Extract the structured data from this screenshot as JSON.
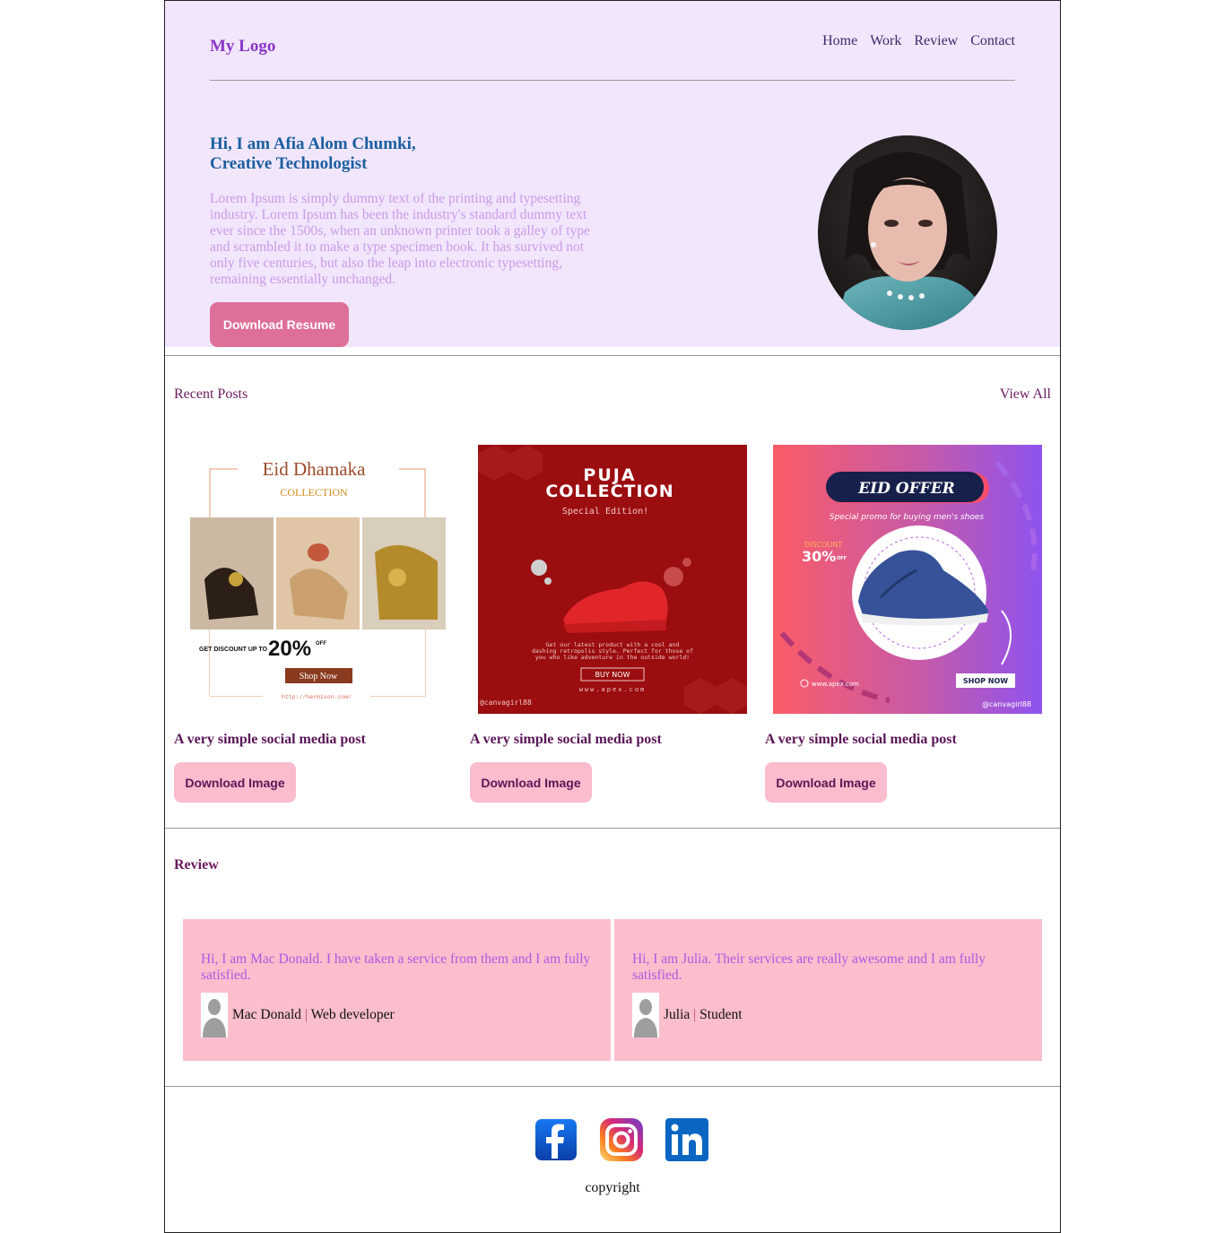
{
  "header": {
    "logo": "My Logo",
    "nav": [
      "Home",
      "Work",
      "Review",
      "Contact"
    ]
  },
  "hero": {
    "title_line1": "Hi, I am Afia Alom Chumki,",
    "title_line2": "Creative Technologist",
    "text": "Lorem Ipsum is simply dummy text of the printing and typesetting industry. Lorem Ipsum has been the industry's standard dummy text ever since the 1500s, when an unknown printer took a galley of type and scrambled it to make a type specimen book. It has survived not only five centuries, but also the leap into electronic typesetting, remaining essentially unchanged.",
    "button": "Download Resume"
  },
  "posts": {
    "title": "Recent Posts",
    "view_all": "View All",
    "items": [
      {
        "caption": "A very simple social media post",
        "button": "Download Image",
        "image_text": {
          "heading": "Eid Dhamaka",
          "sub": "COLLECTION",
          "discount_prefix": "GET DISCOUNT UP TO",
          "discount": "20%",
          "discount_suffix": "OFF",
          "cta": "Shop Now",
          "url": "http://hermison.com/"
        }
      },
      {
        "caption": "A very simple social media post",
        "button": "Download Image",
        "image_text": {
          "heading1": "PUJA",
          "heading2": "COLLECTION",
          "sub": "Special Edition!",
          "body1": "Get our latest product with a cool and",
          "body2": "dashing retropolis style. Perfect for those of",
          "body3": "you who like adventure in the outside world!",
          "cta": "BUY NOW",
          "url": "www.apex.com",
          "handle": "@canvagirl88"
        }
      },
      {
        "caption": "A very simple social media post",
        "button": "Download Image",
        "image_text": {
          "heading": "EID OFFER",
          "sub": "Special promo for buying men's shoes",
          "discount_label": "DISCOUNT",
          "discount": "30%",
          "discount_suffix": "OFF",
          "url": "www.apex.com",
          "cta": "SHOP NOW",
          "handle": "@canvagirl88"
        }
      }
    ]
  },
  "review": {
    "title": "Review",
    "items": [
      {
        "text": "Hi, I am Mac Donald. I have taken a service from them and I am fully satisfied.",
        "name": "Mac Donald",
        "separator": "|",
        "role": "Web developer"
      },
      {
        "text": "Hi, I am Julia. Their services are really awesome and I am fully satisfied.",
        "name": "Julia",
        "separator": "|",
        "role": "Student"
      }
    ]
  },
  "footer": {
    "socials": [
      "facebook-icon",
      "instagram-icon",
      "linkedin-icon"
    ],
    "copyright": "copyright"
  },
  "colors": {
    "hero_bg": "#f1e6fc",
    "logo": "#8a35c9",
    "hero_title": "#1b5fa0",
    "resume_button": "#de6f98",
    "download_button": "#fbbccd",
    "review_card": "#fbbecd"
  }
}
